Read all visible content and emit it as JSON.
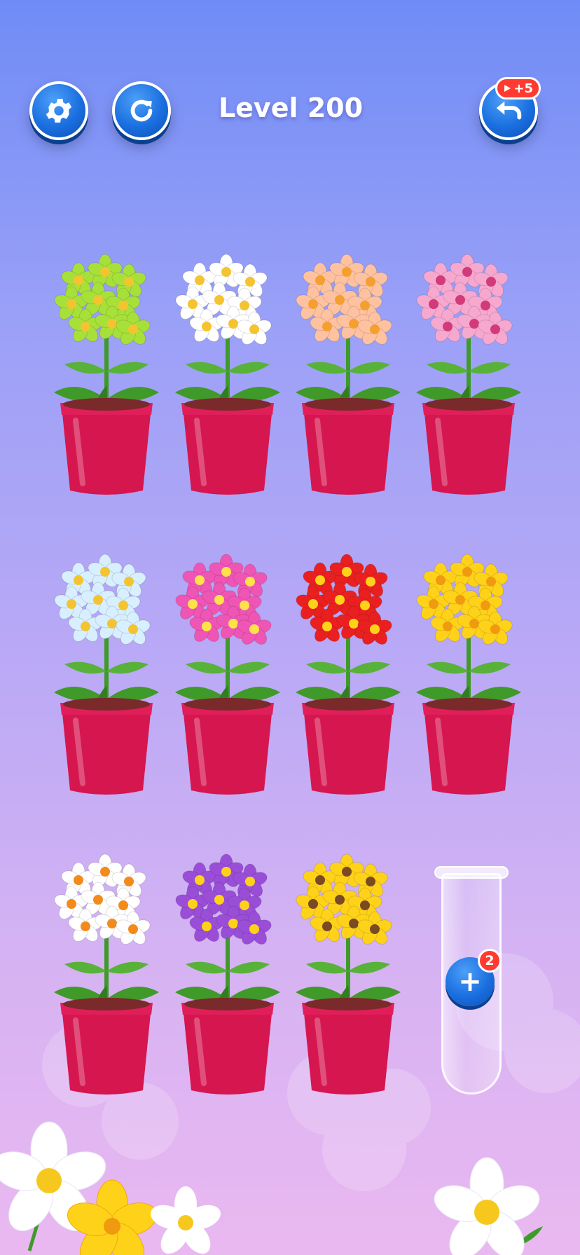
{
  "header": {
    "level_label": "Level 200",
    "undo_badge": "+5",
    "settings_icon": "gear-icon",
    "restart_icon": "restart-icon",
    "undo_icon": "undo-arrow-icon",
    "undo_badge_icon": "video-ad-icon"
  },
  "colors": {
    "button_blue": "#1a6fe0",
    "badge_red": "#ff3b30",
    "pot_red": "#d6164f",
    "leaf_green": "#3f9a2a"
  },
  "pots": [
    {
      "flower": "green-daisy",
      "petal": "#a8e03a",
      "center": "#f4c430"
    },
    {
      "flower": "white-daisy",
      "petal": "#ffffff",
      "center": "#f4c430"
    },
    {
      "flower": "peach-daisy",
      "petal": "#ffc2a0",
      "center": "#f4a030"
    },
    {
      "flower": "pink-blossom",
      "petal": "#f7a8cf",
      "center": "#d23a7a"
    },
    {
      "flower": "light-blue-daisy",
      "petal": "#d7efff",
      "center": "#f4c430"
    },
    {
      "flower": "magenta-daisy",
      "petal": "#ef55b5",
      "center": "#ffe14a"
    },
    {
      "flower": "red-daisy",
      "petal": "#ea2020",
      "center": "#ffd21a"
    },
    {
      "flower": "yellow-blossom",
      "petal": "#ffd21a",
      "center": "#f09a10"
    },
    {
      "flower": "white-narcissus",
      "petal": "#ffffff",
      "center": "#f28a1c"
    },
    {
      "flower": "purple-pansy",
      "petal": "#9a4ed8",
      "center": "#ffd21a"
    },
    {
      "flower": "sunflower",
      "petal": "#ffd21a",
      "center": "#7a4a22"
    }
  ],
  "tube": {
    "add_badge": "2",
    "add_icon": "plus-icon"
  }
}
